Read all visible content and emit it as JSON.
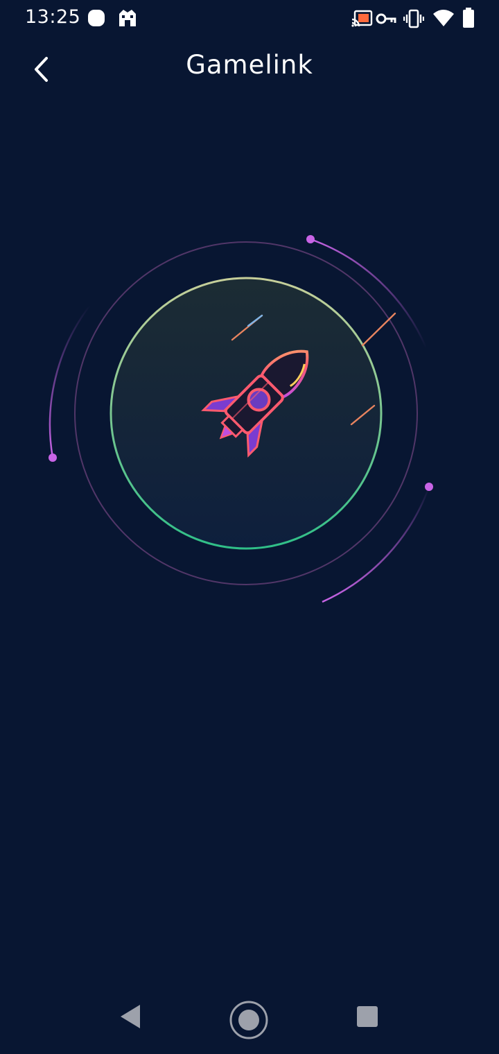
{
  "status_bar": {
    "time": "13:25",
    "left_icons": [
      "notification-dot-icon",
      "castle-icon"
    ],
    "right_icons": [
      "cast-icon",
      "vpn-key-icon",
      "vibrate-icon",
      "wifi-icon",
      "battery-icon"
    ]
  },
  "header": {
    "title": "Gamelink",
    "back_icon": "chevron-left-icon"
  },
  "hero": {
    "illustration": "rocket-icon",
    "inner_ring_colors": [
      "#c7cf9a",
      "#2fbf88"
    ],
    "orbit_accent": "#c864e6"
  },
  "nav_bar": {
    "buttons": [
      "back-triangle-icon",
      "home-circle-icon",
      "recents-square-icon"
    ]
  },
  "colors": {
    "background": "#081632",
    "accent": "#c864e6",
    "rocket": "#ff5a6e"
  }
}
